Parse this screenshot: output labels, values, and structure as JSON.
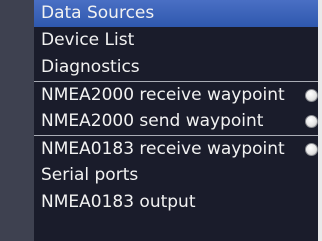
{
  "menu": {
    "items": [
      {
        "label": "Data Sources",
        "selected": true
      },
      {
        "label": "Device List"
      },
      {
        "label": "Diagnostics"
      },
      {
        "label": "NMEA2000 receive waypoint",
        "toggle": true
      },
      {
        "label": "NMEA2000 send waypoint",
        "toggle": true
      },
      {
        "label": "NMEA0183 receive waypoint",
        "toggle": true
      },
      {
        "label": "Serial ports"
      },
      {
        "label": "NMEA0183 output"
      }
    ]
  },
  "colors": {
    "background": "#1a1c2b",
    "selection": "#3a63b8",
    "text": "#f2f2f2"
  }
}
